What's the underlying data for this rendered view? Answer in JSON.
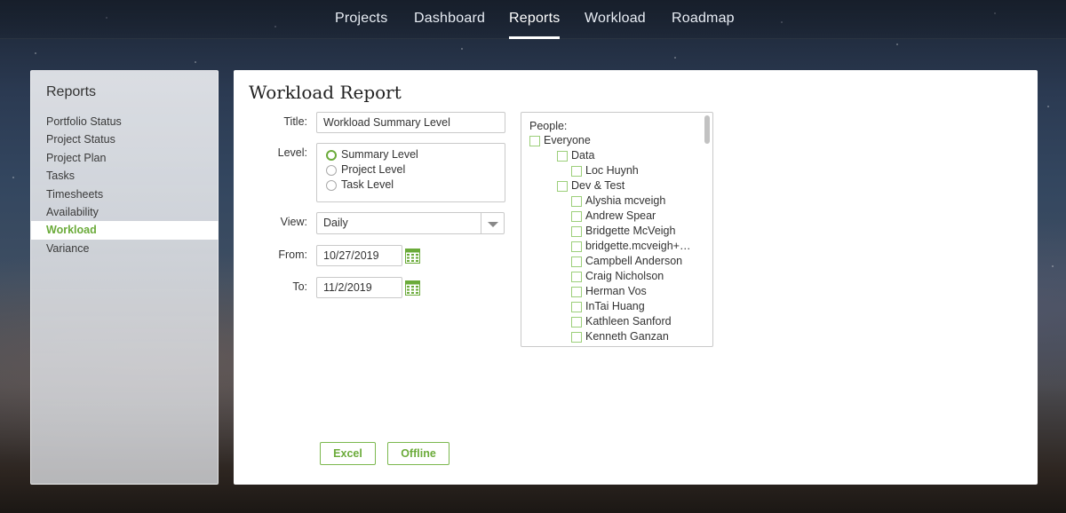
{
  "nav": {
    "items": [
      "Projects",
      "Dashboard",
      "Reports",
      "Workload",
      "Roadmap"
    ],
    "active": "Reports"
  },
  "sidebar": {
    "title": "Reports",
    "items": [
      "Portfolio Status",
      "Project Status",
      "Project Plan",
      "Tasks",
      "Timesheets",
      "Availability",
      "Workload",
      "Variance"
    ],
    "active": "Workload"
  },
  "report": {
    "heading": "Workload Report",
    "title_label": "Title:",
    "title_value": "Workload Summary Level",
    "level_label": "Level:",
    "levels": [
      "Summary Level",
      "Project Level",
      "Task Level"
    ],
    "selected_level": "Summary Level",
    "view_label": "View:",
    "view_value": "Daily",
    "from_label": "From:",
    "from_value": "10/27/2019",
    "to_label": "To:",
    "to_value": "11/2/2019"
  },
  "people": {
    "label": "People:",
    "tree": [
      {
        "label": "Everyone",
        "level": 0
      },
      {
        "label": "Data",
        "level": 1
      },
      {
        "label": "Loc Huynh",
        "level": 2
      },
      {
        "label": "Dev & Test",
        "level": 1
      },
      {
        "label": "Alyshia mcveigh",
        "level": 2
      },
      {
        "label": "Andrew Spear",
        "level": 2
      },
      {
        "label": "Bridgette McVeigh",
        "level": 2
      },
      {
        "label": "bridgette.mcveigh+…",
        "level": 2
      },
      {
        "label": "Campbell Anderson",
        "level": 2
      },
      {
        "label": "Craig Nicholson",
        "level": 2
      },
      {
        "label": "Herman Vos",
        "level": 2
      },
      {
        "label": "InTai Huang",
        "level": 2
      },
      {
        "label": "Kathleen Sanford",
        "level": 2
      },
      {
        "label": "Kenneth Ganzan",
        "level": 2
      }
    ]
  },
  "buttons": {
    "excel": "Excel",
    "offline": "Offline"
  },
  "colors": {
    "accent": "#6bab3a",
    "checkbox_border": "#9ccf7a"
  }
}
